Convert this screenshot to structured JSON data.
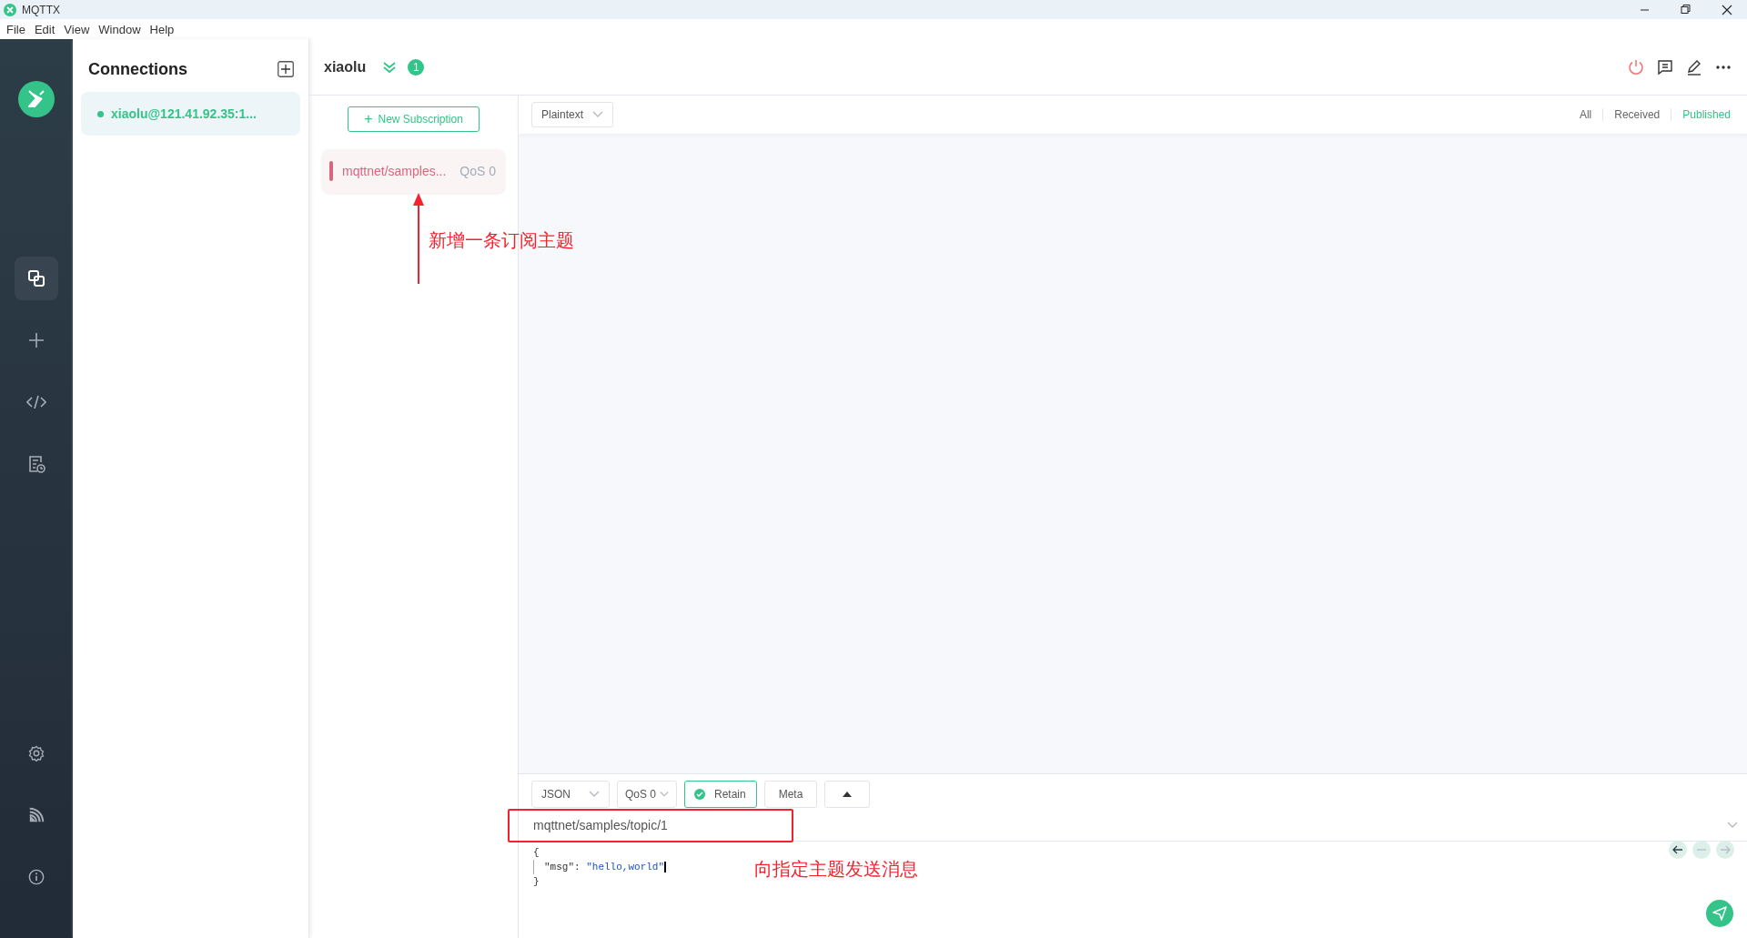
{
  "window": {
    "title": "MQTTX"
  },
  "menu": [
    "File",
    "Edit",
    "View",
    "Window",
    "Help"
  ],
  "nav": {
    "items": [
      {
        "kind": "connections",
        "selected": true
      },
      {
        "kind": "new",
        "selected": false
      },
      {
        "kind": "script",
        "selected": false
      },
      {
        "kind": "log",
        "selected": false
      }
    ],
    "bottom": [
      {
        "kind": "settings"
      },
      {
        "kind": "feed"
      },
      {
        "kind": "about"
      }
    ]
  },
  "connections": {
    "title": "Connections",
    "items": [
      {
        "name": "xiaolu@121.41.92.35:1...",
        "online": true,
        "selected": true
      }
    ]
  },
  "header": {
    "name": "xiaolu",
    "badge": "1"
  },
  "subscriptions": {
    "button_icon": "+",
    "button": "New Subscription",
    "items": [
      {
        "topic": "mqttnet/samples...",
        "qos": "QoS 0",
        "color": "#d9667a"
      }
    ]
  },
  "messages": {
    "format": "Plaintext",
    "filters": [
      {
        "label": "All",
        "selected": false
      },
      {
        "label": "Received",
        "selected": false
      },
      {
        "label": "Published",
        "selected": true
      }
    ]
  },
  "publish": {
    "format": "JSON",
    "qos": "QoS 0",
    "retain": true,
    "retain_label": "Retain",
    "meta": "Meta",
    "topic": "mqttnet/samples/topic/1",
    "payload": {
      "open": "{",
      "key": "\"msg\":",
      "value": "\"hello,world\"",
      "close": "}"
    }
  },
  "annotations": [
    {
      "text": "新增一条订阅主题"
    },
    {
      "text": "向指定主题发送消息"
    }
  ]
}
